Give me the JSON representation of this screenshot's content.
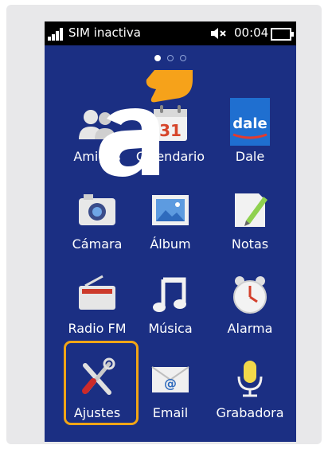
{
  "status": {
    "carrier": "SIM inactiva",
    "time": "00:04",
    "icons": [
      "signal-icon",
      "mute-icon",
      "battery-icon"
    ]
  },
  "pager": {
    "pages": 3,
    "active": 0
  },
  "apps": [
    {
      "label": "Amigos",
      "icon": "friends-icon"
    },
    {
      "label": "Calendario",
      "icon": "calendar-icon",
      "badge": "31"
    },
    {
      "label": "Dale",
      "icon": "dale-icon",
      "badge": "dale"
    },
    {
      "label": "Cámara",
      "icon": "camera-icon"
    },
    {
      "label": "Álbum",
      "icon": "album-icon"
    },
    {
      "label": "Notas",
      "icon": "notes-icon"
    },
    {
      "label": "Radio FM",
      "icon": "radio-icon"
    },
    {
      "label": "Música",
      "icon": "music-icon"
    },
    {
      "label": "Alarma",
      "icon": "alarm-icon"
    },
    {
      "label": "Ajustes",
      "icon": "settings-icon"
    },
    {
      "label": "Email",
      "icon": "email-icon"
    },
    {
      "label": "Grabadora",
      "icon": "microphone-icon"
    }
  ],
  "overlay": {
    "logo_letter": "a",
    "logo_colors": [
      "#ffffff",
      "#f6a21a"
    ]
  },
  "colors": {
    "screen_bg": "#1b2f83",
    "highlight": "#f2a516"
  }
}
